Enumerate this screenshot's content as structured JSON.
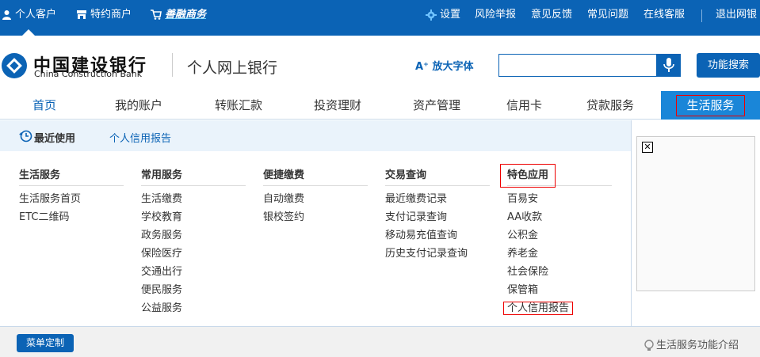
{
  "topbar": {
    "personal": "个人客户",
    "merchant": "特约商户",
    "shanrong": "善融商务",
    "settings": "设置",
    "risk_report": "风险举报",
    "feedback": "意见反馈",
    "faq": "常见问题",
    "online_service": "在线客服",
    "logout": "退出网银"
  },
  "header": {
    "bank_cn": "中国建设银行",
    "bank_en": "China Construction Bank",
    "netbank": "个人网上银行",
    "enlarge_font": "放大字体",
    "search_value": "",
    "func_search": "功能搜索"
  },
  "nav": {
    "items": [
      "首页",
      "我的账户",
      "转账汇款",
      "投资理财",
      "资产管理",
      "信用卡",
      "贷款服务",
      "生活服务"
    ]
  },
  "recent": {
    "title": "最近使用",
    "link": "个人信用报告"
  },
  "columns": [
    {
      "title": "生活服务",
      "items": [
        "生活服务首页",
        "ETC二维码"
      ]
    },
    {
      "title": "常用服务",
      "items": [
        "生活缴费",
        "学校教育",
        "政务服务",
        "保险医疗",
        "交通出行",
        "便民服务",
        "公益服务"
      ]
    },
    {
      "title": "便捷缴费",
      "items": [
        "自动缴费",
        "银校签约"
      ]
    },
    {
      "title": "交易查询",
      "items": [
        "最近缴费记录",
        "支付记录查询",
        "移动易充值查询",
        "历史支付记录查询"
      ]
    },
    {
      "title": "特色应用",
      "items": [
        "百易安",
        "AA收款",
        "公积金",
        "养老金",
        "社会保险",
        "保管箱",
        "个人信用报告"
      ]
    }
  ],
  "ad": {
    "close": "✕"
  },
  "bottom": {
    "menu_custom": "菜单定制",
    "intro": "生活服务功能介绍"
  },
  "colors": {
    "primary": "#0b63b5",
    "active_tab": "#1a86d8",
    "highlight": "#ee0000"
  }
}
